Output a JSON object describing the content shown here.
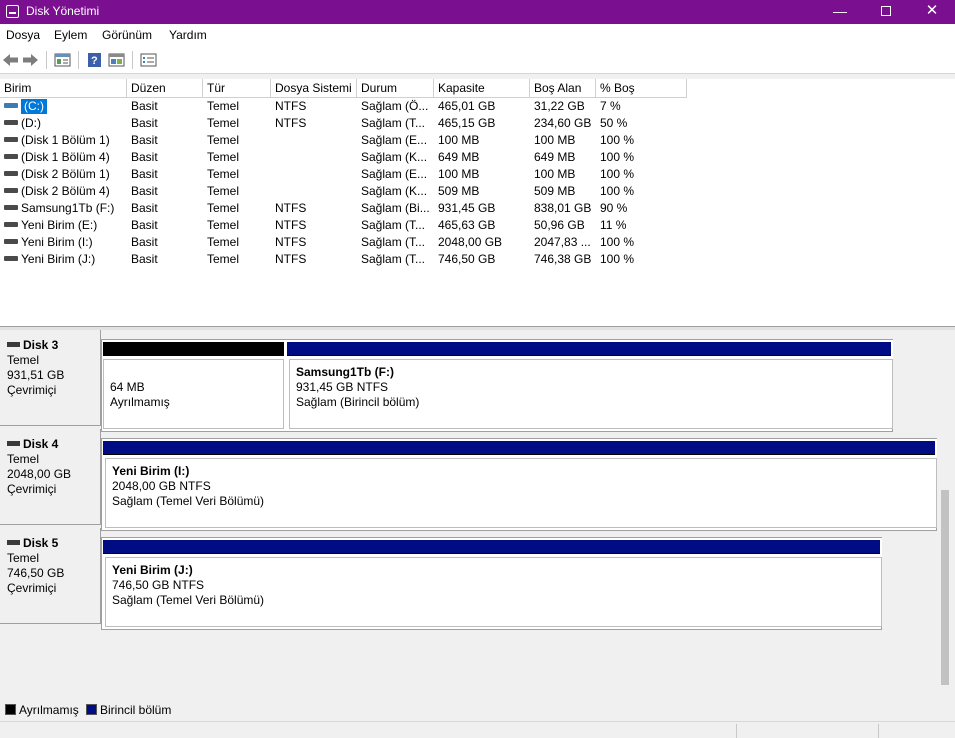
{
  "window": {
    "title": "Disk Yönetimi",
    "minimize": "—",
    "close": "✕"
  },
  "menu": [
    "Dosya",
    "Eylem",
    "Görünüm",
    "Yardım"
  ],
  "toolbar": {
    "icons": [
      "back-arrow-icon",
      "forward-arrow-icon",
      "properties-icon",
      "help-icon",
      "refresh-view-icon",
      "list-view-icon"
    ]
  },
  "list": {
    "headers": [
      "Birim",
      "Düzen",
      "Tür",
      "Dosya Sistemi",
      "Durum",
      "Kapasite",
      "Boş Alan",
      "% Boş"
    ],
    "rows": [
      [
        "(C:)",
        "Basit",
        "Temel",
        "NTFS",
        "Sağlam (Ö...",
        "465,01 GB",
        "31,22 GB",
        "7 %"
      ],
      [
        "(D:)",
        "Basit",
        "Temel",
        "NTFS",
        "Sağlam (T...",
        "465,15 GB",
        "234,60 GB",
        "50 %"
      ],
      [
        "(Disk 1 Bölüm 1)",
        "Basit",
        "Temel",
        "",
        "Sağlam (E...",
        "100 MB",
        "100 MB",
        "100 %"
      ],
      [
        "(Disk 1 Bölüm 4)",
        "Basit",
        "Temel",
        "",
        "Sağlam (K...",
        "649 MB",
        "649 MB",
        "100 %"
      ],
      [
        "(Disk 2 Bölüm 1)",
        "Basit",
        "Temel",
        "",
        "Sağlam (E...",
        "100 MB",
        "100 MB",
        "100 %"
      ],
      [
        "(Disk 2 Bölüm 4)",
        "Basit",
        "Temel",
        "",
        "Sağlam (K...",
        "509 MB",
        "509 MB",
        "100 %"
      ],
      [
        "Samsung1Tb (F:)",
        "Basit",
        "Temel",
        "NTFS",
        "Sağlam (Bi...",
        "931,45 GB",
        "838,01 GB",
        "90 %"
      ],
      [
        "Yeni Birim (E:)",
        "Basit",
        "Temel",
        "NTFS",
        "Sağlam (T...",
        "465,63 GB",
        "50,96 GB",
        "11 %"
      ],
      [
        "Yeni Birim (I:)",
        "Basit",
        "Temel",
        "NTFS",
        "Sağlam (T...",
        "2048,00 GB",
        "2047,83 ...",
        "100 %"
      ],
      [
        "Yeni Birim (J:)",
        "Basit",
        "Temel",
        "NTFS",
        "Sağlam (T...",
        "746,50 GB",
        "746,38 GB",
        "100 %"
      ]
    ],
    "selected_index": 0
  },
  "disks": [
    {
      "name": "Disk 3",
      "type": "Temel",
      "size": "931,51 GB",
      "status": "Çevrimiçi",
      "partitions": [
        {
          "kind": "unalloc",
          "name": "",
          "line1": "64 MB",
          "line2": "Ayrılmamış"
        },
        {
          "kind": "primary",
          "name": "Samsung1Tb  (F:)",
          "line1": "931,45 GB NTFS",
          "line2": "Sağlam (Birincil bölüm)"
        }
      ]
    },
    {
      "name": "Disk 4",
      "type": "Temel",
      "size": "2048,00 GB",
      "status": "Çevrimiçi",
      "partitions": [
        {
          "kind": "primary",
          "name": "Yeni Birim  (I:)",
          "line1": "2048,00 GB NTFS",
          "line2": "Sağlam (Temel Veri Bölümü)"
        }
      ]
    },
    {
      "name": "Disk 5",
      "type": "Temel",
      "size": "746,50 GB",
      "status": "Çevrimiçi",
      "partitions": [
        {
          "kind": "primary",
          "name": "Yeni Birim  (J:)",
          "line1": "746,50 GB NTFS",
          "line2": "Sağlam (Temel Veri Bölümü)"
        }
      ]
    }
  ],
  "legend": {
    "unallocated": "Ayrılmamış",
    "primary": "Birincil bölüm",
    "unallocated_color": "#000000",
    "primary_color": "#000c84"
  },
  "colors": {
    "titlebar": "#7a0f8f",
    "selection": "#0078d7"
  }
}
